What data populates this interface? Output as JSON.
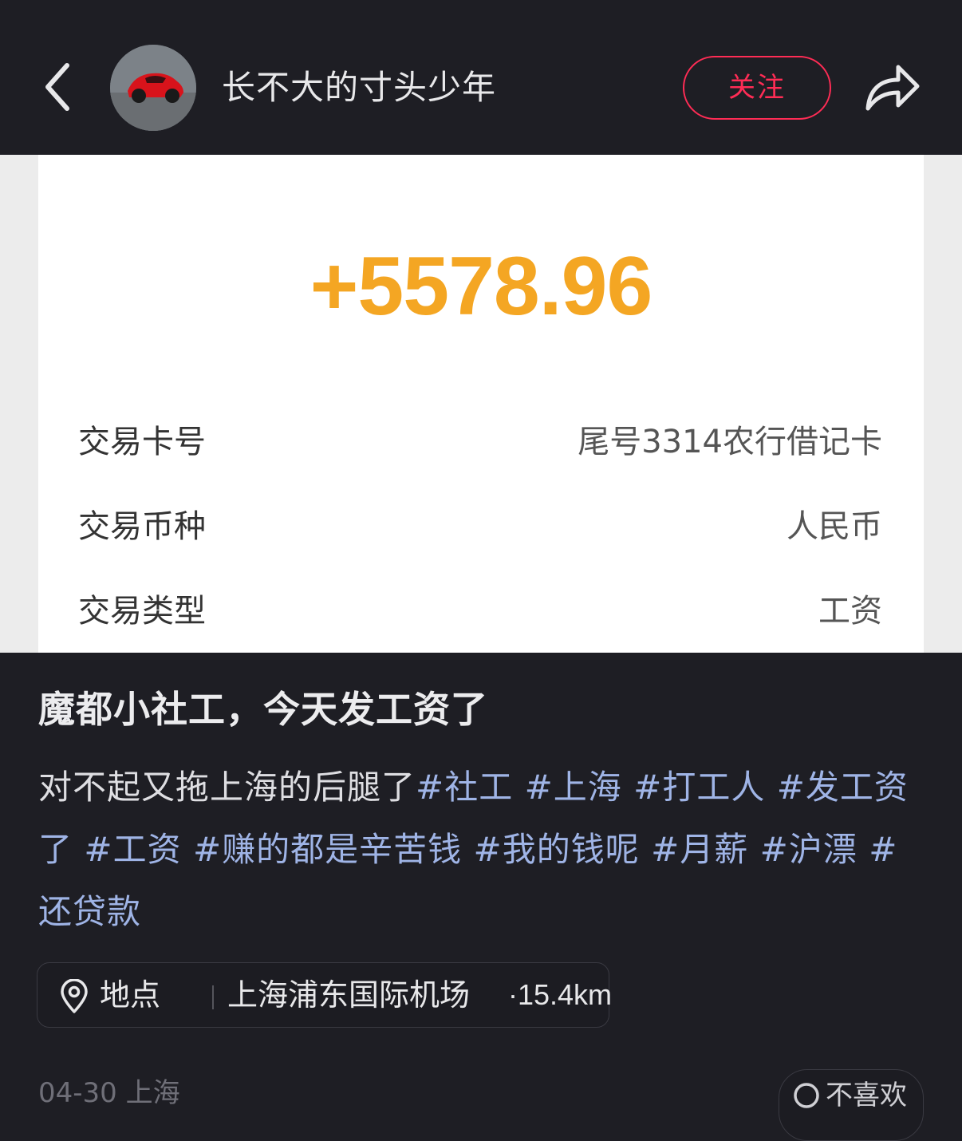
{
  "header": {
    "username": "长不大的寸头少年",
    "follow_label": "关注"
  },
  "transaction": {
    "amount": "+5578.96",
    "amount_color": "#f4a623",
    "rows": [
      {
        "label": "交易卡号",
        "value": "尾号3314农行借记卡"
      },
      {
        "label": "交易币种",
        "value": "人民币"
      },
      {
        "label": "交易类型",
        "value": "工资"
      }
    ]
  },
  "post": {
    "title": "魔都小社工，今天发工资了",
    "text": "对不起又拖上海的后腿了",
    "tags": [
      "#社工",
      "#上海",
      "#打工人",
      "#发工资了",
      "#工资",
      "#赚的都是辛苦钱",
      "#我的钱呢",
      "#月薪",
      "#沪漂",
      "#还贷款"
    ]
  },
  "location": {
    "label": "地点",
    "name": "上海浦东国际机场",
    "distance": "·15.4km"
  },
  "meta": {
    "date_place": "04-30 上海",
    "dislike_label": "不喜欢"
  },
  "colors": {
    "accent_red": "#ff2c55",
    "tag_blue": "#9fb4e6"
  }
}
